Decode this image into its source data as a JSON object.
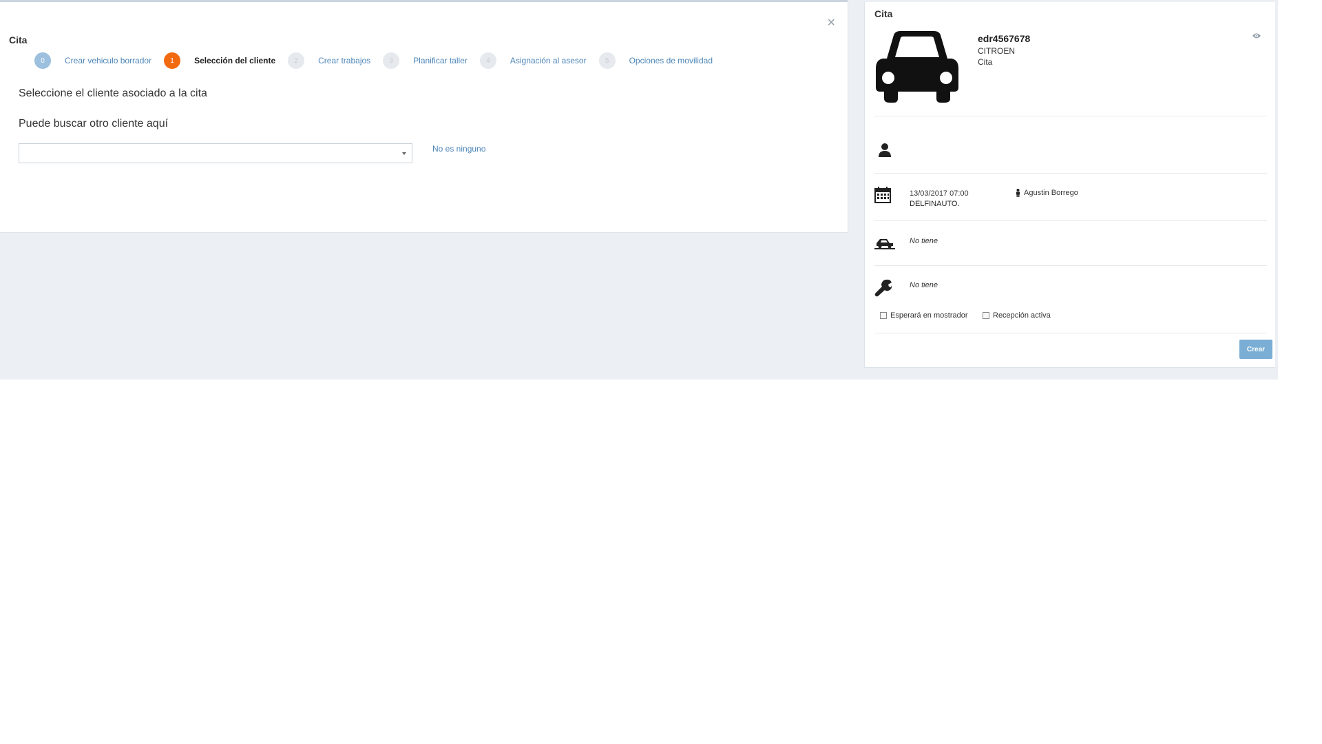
{
  "wizard": {
    "title": "Cita",
    "close_label": "×",
    "steps": [
      {
        "number": "0",
        "label": "Crear vehiculo borrador",
        "state": "done"
      },
      {
        "number": "1",
        "label": "Selección del cliente",
        "state": "active"
      },
      {
        "number": "2",
        "label": "Crear trabajos",
        "state": "todo"
      },
      {
        "number": "3",
        "label": "Planificar taller",
        "state": "todo"
      },
      {
        "number": "4",
        "label": "Asignación al asesor",
        "state": "todo"
      },
      {
        "number": "5",
        "label": "Opciones de movilidad",
        "state": "todo"
      }
    ],
    "heading": "Seleccione el cliente asociado a la cita",
    "search_label": "Puede buscar otro cliente aquí",
    "select_value": "",
    "none_link": "No es ninguno"
  },
  "summary": {
    "title": "Cita",
    "vehicle": {
      "id": "edr4567678",
      "brand": "CITROEN",
      "type": "Cita"
    },
    "appointment": {
      "datetime": "13/03/2017 07:00",
      "dealer": "DELFINAUTO.",
      "advisor": "Agustin Borrego"
    },
    "mobility": "No tiene",
    "works": "No tiene",
    "checkboxes": {
      "wait_counter": "Esperará en mostrador",
      "active_reception": "Recepción activa"
    },
    "create_button": "Crear"
  },
  "colors": {
    "active_step": "#f26a10",
    "done_step": "#9cc0de",
    "link": "#4d86b8",
    "primary_button": "#7aaed4",
    "backdrop": "#eceff3"
  },
  "icons": [
    "close-icon",
    "car-icon",
    "eye-icon",
    "user-icon",
    "calendar-icon",
    "person-icon",
    "tow-truck-icon",
    "wrench-icon",
    "chevron-down-icon"
  ]
}
